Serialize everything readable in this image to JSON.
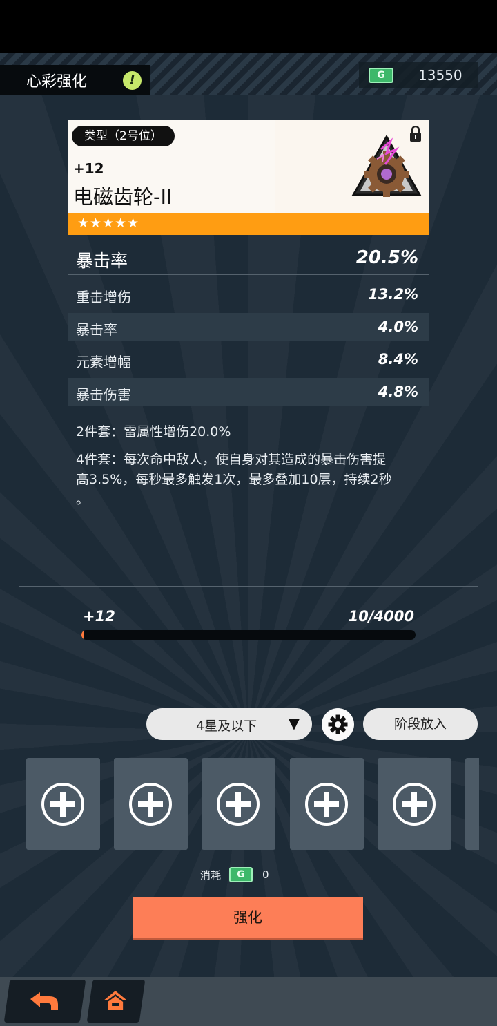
{
  "header": {
    "title": "心彩强化",
    "alert_icon": "exclamation-icon",
    "currency_icon_label": "G",
    "currency_value": "13550"
  },
  "card": {
    "type_label": "类型（2号位）",
    "level": "+12",
    "name": "电磁齿轮-II",
    "stars": "★★★★★",
    "star_count": 5,
    "bar_color": "#ff9d12"
  },
  "main_stat": {
    "label": "暴击率",
    "value": "20.5%"
  },
  "sub_stats": [
    {
      "label": "重击增伤",
      "value": "13.2%"
    },
    {
      "label": "暴击率",
      "value": "4.0%"
    },
    {
      "label": "元素增幅",
      "value": "8.4%"
    },
    {
      "label": "暴击伤害",
      "value": "4.8%"
    }
  ],
  "set_bonus": {
    "two_piece": "2件套：雷属性增伤20.0%",
    "four_piece_line1": "4件套：每次命中敌人，使自身对其造成的暴击伤害提",
    "four_piece_line2": "高3.5%，每秒最多触发1次，最多叠加10层，持续2秒",
    "four_piece_line3": "。"
  },
  "progress": {
    "level": "+12",
    "exp_text": "10/4000",
    "fraction": 0.0025
  },
  "filter": {
    "selected": "4星及以下",
    "arrow": "▼",
    "stage_button": "阶段放入"
  },
  "slots": {
    "count_visible": 5,
    "icon": "plus-circle-icon"
  },
  "cost": {
    "label": "消耗",
    "icon_label": "G",
    "value": "0"
  },
  "enhance_button": "强化",
  "colors": {
    "accent_orange": "#fd7e57",
    "star_bar": "#ff9d12",
    "currency_green": "#3db86a"
  }
}
